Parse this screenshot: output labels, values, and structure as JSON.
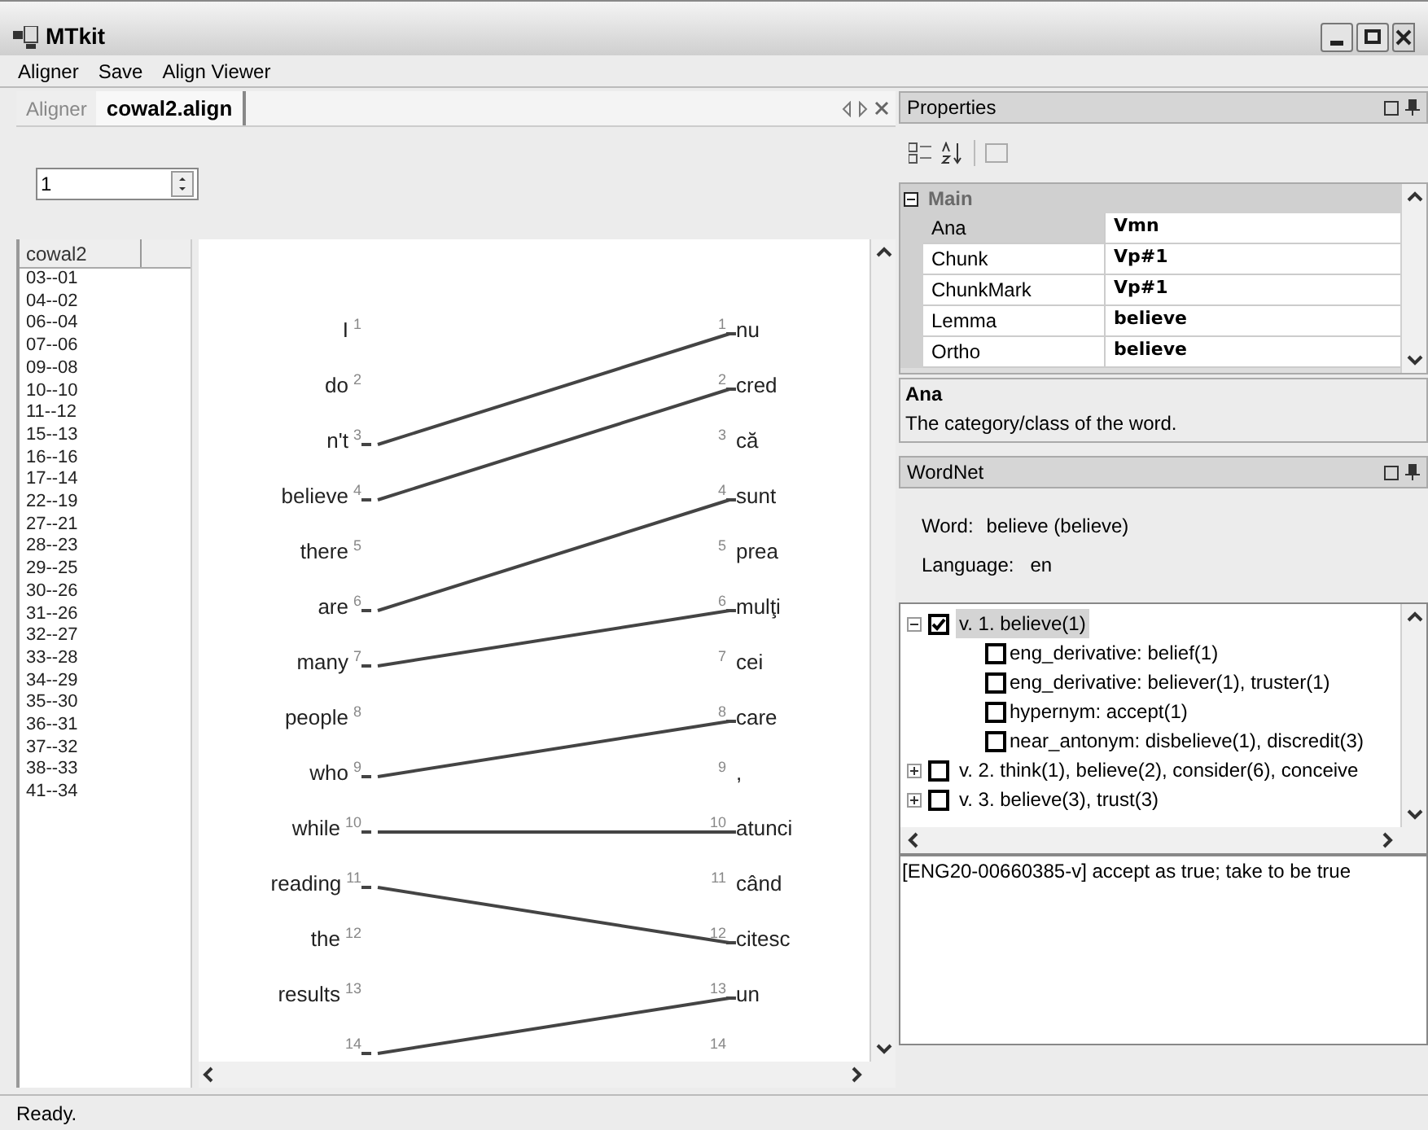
{
  "window": {
    "title": "MTkit"
  },
  "menu": [
    "Aligner",
    "Save",
    "Align Viewer"
  ],
  "tabs": [
    {
      "label": "Aligner",
      "selected": false
    },
    {
      "label": "cowal2.align",
      "selected": true
    }
  ],
  "spinner": {
    "value": "1"
  },
  "pair_list": {
    "columns": [
      "cowal2"
    ],
    "items": [
      "03--01",
      "04--02",
      "06--04",
      "07--06",
      "09--08",
      "10--10",
      "11--12",
      "15--13",
      "16--16",
      "17--14",
      "22--19",
      "27--21",
      "28--23",
      "29--25",
      "30--26",
      "31--26",
      "32--27",
      "33--28",
      "34--29",
      "35--30",
      "36--31",
      "37--32",
      "38--33",
      "41--34"
    ]
  },
  "alignment": {
    "source": [
      {
        "word": "I",
        "num": "1",
        "aligned": false
      },
      {
        "word": "do",
        "num": "2",
        "aligned": false
      },
      {
        "word": "n't",
        "num": "3",
        "aligned": true
      },
      {
        "word": "believe",
        "num": "4",
        "aligned": true
      },
      {
        "word": "there",
        "num": "5",
        "aligned": false
      },
      {
        "word": "are",
        "num": "6",
        "aligned": true
      },
      {
        "word": "many",
        "num": "7",
        "aligned": true
      },
      {
        "word": "people",
        "num": "8",
        "aligned": false
      },
      {
        "word": "who",
        "num": "9",
        "aligned": true
      },
      {
        "word": "while",
        "num": "10",
        "aligned": true
      },
      {
        "word": "reading",
        "num": "11",
        "aligned": true
      },
      {
        "word": "the",
        "num": "12",
        "aligned": false
      },
      {
        "word": "results",
        "num": "13",
        "aligned": false
      },
      {
        "num": "14",
        "aligned": true
      }
    ],
    "target": [
      {
        "word": "nu",
        "num": "1",
        "aligned": true
      },
      {
        "word": "cred",
        "num": "2",
        "aligned": true
      },
      {
        "word": "că",
        "num": "3",
        "aligned": false
      },
      {
        "word": "sunt",
        "num": "4",
        "aligned": true
      },
      {
        "word": "prea",
        "num": "5",
        "aligned": false
      },
      {
        "word": "mulţi",
        "num": "6",
        "aligned": true
      },
      {
        "word": "cei",
        "num": "7",
        "aligned": false
      },
      {
        "word": "care",
        "num": "8",
        "aligned": true
      },
      {
        "word": ",",
        "num": "9",
        "aligned": false
      },
      {
        "word": "atunci",
        "num": "10",
        "aligned": true
      },
      {
        "word": "când",
        "num": "11",
        "aligned": false
      },
      {
        "word": "citesc",
        "num": "12",
        "aligned": true
      },
      {
        "word": "un",
        "num": "13",
        "aligned": true
      },
      {
        "num": "14",
        "aligned": false
      }
    ]
  },
  "properties": {
    "title": "Properties",
    "category": "Main",
    "rows": [
      {
        "name": "Ana",
        "value": "Vmn",
        "selected": true
      },
      {
        "name": "Chunk",
        "value": "Vp#1",
        "selected": false
      },
      {
        "name": "ChunkMark",
        "value": "Vp#1",
        "selected": false
      },
      {
        "name": "Lemma",
        "value": "believe",
        "selected": false
      },
      {
        "name": "Ortho",
        "value": "believe",
        "selected": false
      }
    ],
    "description": {
      "title": "Ana",
      "text": "The category/class of the word."
    }
  },
  "wordnet": {
    "title": "WordNet",
    "word_label": "Word:",
    "word": "believe (believe)",
    "language_label": "Language:",
    "language": "en",
    "tree": [
      {
        "label": "v.  1. believe(1)",
        "checked": true,
        "expanded": true,
        "selected": true,
        "children": [
          {
            "label": "eng_derivative: belief(1)",
            "checked": false
          },
          {
            "label": "eng_derivative: believer(1), truster(1)",
            "checked": false
          },
          {
            "label": "hypernym: accept(1)",
            "checked": false
          },
          {
            "label": "near_antonym: disbelieve(1), discredit(3)",
            "checked": false
          }
        ]
      },
      {
        "label": "v.  2. think(1), believe(2), consider(6), conceive",
        "checked": false,
        "expanded": false,
        "selected": false
      },
      {
        "label": "v.  3. believe(3), trust(3)",
        "checked": false,
        "expanded": false,
        "selected": false
      }
    ],
    "definition": "[ENG20-00660385-v] accept as true; take to be true"
  },
  "status_bar": "Ready."
}
